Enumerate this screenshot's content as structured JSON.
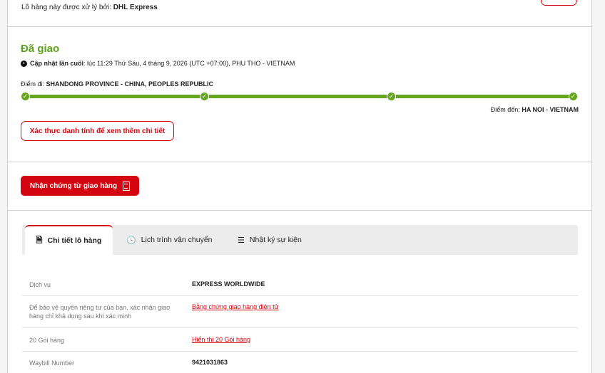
{
  "handler": {
    "prefix": "Lô hàng này được xử lý bởi: ",
    "carrier": "DHL Express"
  },
  "status": {
    "title": "Đã giao",
    "update_label": "Cập nhật lần cuối",
    "update_text": ": lúc 11:29 Thứ Sáu, 4 tháng 9, 2026 (UTC +07:00), PHU THO - VIETNAM",
    "origin_label": "Điểm đi: ",
    "origin_value": "SHANDONG PROVINCE - CHINA, PEOPLES REPUBLIC",
    "dest_label": "Điểm đến: ",
    "dest_value": "HA NOI - VIETNAM",
    "progress_checkmark": "✓",
    "verify_button": "Xác thực danh tính để xem thêm chi tiết"
  },
  "proof": {
    "button_label": "Nhận chứng từ giao hàng"
  },
  "tabs": [
    {
      "label": "Chi tiết lô hàng",
      "icon": "document-icon"
    },
    {
      "label": "Lịch trình vận chuyển",
      "icon": "clock-icon"
    },
    {
      "label": "Nhật ký sự kiện",
      "icon": "list-icon"
    }
  ],
  "details": {
    "service_label": "Dịch vụ",
    "service_value": "EXPRESS WORLDWIDE",
    "privacy_label": "Để bảo vệ quyền riêng tư của bạn, xác nhận giao hàng chỉ khả dụng sau khi xác minh",
    "privacy_link": "Bằng chứng giao hàng điện tử",
    "pieces_label": "20 Gói hàng",
    "pieces_link": "Hiển thị 20 Gói hàng",
    "waybill_label": "Waybill Number",
    "waybill_value": "9421031863"
  },
  "colors": {
    "accent_red": "#d40511",
    "success_green": "#66a61e"
  }
}
